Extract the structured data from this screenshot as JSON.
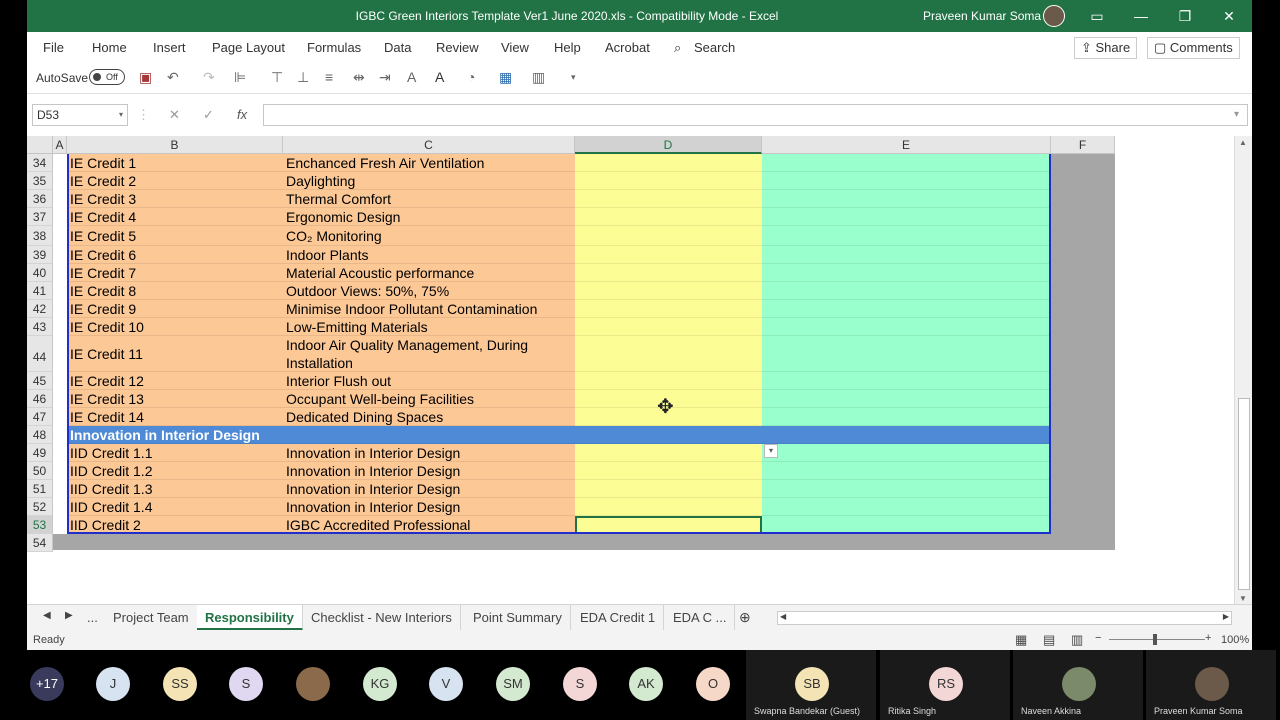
{
  "window": {
    "title": "IGBC Green Interiors Template Ver1 June 2020.xls  -  Compatibility Mode  -  Excel",
    "user": "Praveen Kumar Soma"
  },
  "menu": [
    "File",
    "Home",
    "Insert",
    "Page Layout",
    "Formulas",
    "Data",
    "Review",
    "View",
    "Help",
    "Acrobat"
  ],
  "search_label": "Search",
  "share_label": "Share",
  "comments_label": "Comments",
  "autosave": {
    "label": "AutoSave",
    "state": "Off"
  },
  "formula": {
    "name_box": "D53",
    "fx": "fx",
    "value": ""
  },
  "columns": [
    "A",
    "B",
    "C",
    "D",
    "E",
    "F"
  ],
  "rows": [
    {
      "n": "34",
      "b": "IE Credit 1",
      "c": "Enchanced Fresh Air Ventilation"
    },
    {
      "n": "35",
      "b": "IE Credit 2",
      "c": "Daylighting"
    },
    {
      "n": "36",
      "b": "IE Credit 3",
      "c": "Thermal Comfort"
    },
    {
      "n": "37",
      "b": "IE Credit 4",
      "c": "Ergonomic Design"
    },
    {
      "n": "38",
      "b": "IE Credit 5",
      "c": "CO₂ Monitoring"
    },
    {
      "n": "39",
      "b": "IE Credit 6",
      "c": "Indoor Plants"
    },
    {
      "n": "40",
      "b": "IE Credit 7",
      "c": "Material Acoustic performance"
    },
    {
      "n": "41",
      "b": "IE Credit 8",
      "c": "Outdoor Views: 50%, 75%"
    },
    {
      "n": "42",
      "b": "IE Credit 9",
      "c": "Minimise Indoor Pollutant Contamination"
    },
    {
      "n": "43",
      "b": "IE Credit 10",
      "c": "Low-Emitting Materials"
    },
    {
      "n": "44",
      "b": "IE Credit 11",
      "c": "Indoor Air Quality Management, During Installation"
    },
    {
      "n": "45",
      "b": "IE Credit 12",
      "c": "Interior Flush out"
    },
    {
      "n": "46",
      "b": "IE Credit 13",
      "c": "Occupant Well-being Facilities"
    },
    {
      "n": "47",
      "b": "IE Credit 14",
      "c": "Dedicated Dining Spaces"
    },
    {
      "n": "48",
      "b": "Innovation in Interior Design",
      "c": "",
      "header": true
    },
    {
      "n": "49",
      "b": "IID Credit 1.1",
      "c": "Innovation in Interior Design"
    },
    {
      "n": "50",
      "b": "IID Credit 1.2",
      "c": "Innovation in Interior Design"
    },
    {
      "n": "51",
      "b": "IID Credit 1.3",
      "c": "Innovation in Interior Design"
    },
    {
      "n": "52",
      "b": "IID Credit 1.4",
      "c": "Innovation in Interior Design"
    },
    {
      "n": "53",
      "b": "IID Credit 2",
      "c": "IGBC Accredited Professional"
    },
    {
      "n": "54",
      "b": "",
      "c": "",
      "empty": true
    }
  ],
  "sheets": [
    "...",
    "Project Team",
    "Responsibility",
    "Checklist - New Interiors",
    "Point Summary",
    "EDA Credit 1",
    "EDA C ..."
  ],
  "active_sheet": "Responsibility",
  "status": {
    "ready": "Ready",
    "zoom": "100%"
  },
  "participants": [
    {
      "label": "+17",
      "color": "#3a3a5c"
    },
    {
      "label": "J",
      "color": "#d7e3f0"
    },
    {
      "label": "SS",
      "color": "#f4e3b5"
    },
    {
      "label": "S",
      "color": "#e0d8f0"
    },
    {
      "label": "",
      "color": "#8a6a4a"
    },
    {
      "label": "KG",
      "color": "#d4ead0"
    },
    {
      "label": "V",
      "color": "#d7e3f0"
    },
    {
      "label": "SM",
      "color": "#d4ead0"
    },
    {
      "label": "S",
      "color": "#f3d6d6"
    },
    {
      "label": "AK",
      "color": "#d4ead0"
    },
    {
      "label": "O",
      "color": "#f6d8c8"
    }
  ],
  "tiles": [
    {
      "initials": "SB",
      "name": "Swapna Bandekar (Guest)",
      "color": "#f4e3b5"
    },
    {
      "initials": "RS",
      "name": "Ritika Singh",
      "color": "#f3d6d6"
    },
    {
      "initials": "",
      "name": "Naveen Akkina",
      "color": "#7a8a6a"
    },
    {
      "initials": "",
      "name": "Praveen Kumar Soma",
      "color": "#6b5a4a"
    }
  ]
}
